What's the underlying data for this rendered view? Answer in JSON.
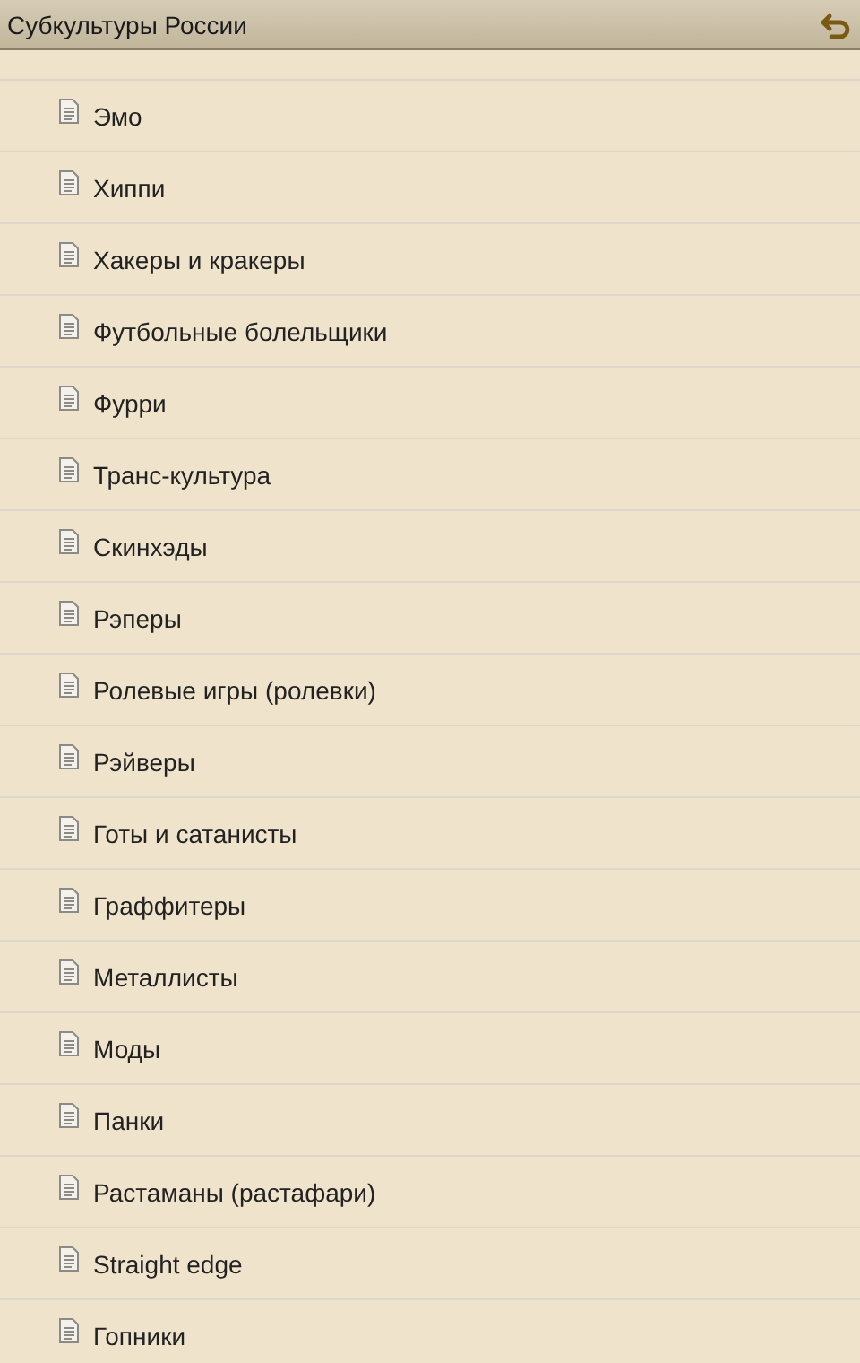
{
  "title_bar": {
    "title": "Субкультуры России"
  },
  "items": [
    {
      "label": "Эмо"
    },
    {
      "label": "Хиппи"
    },
    {
      "label": "Хакеры и кракеры"
    },
    {
      "label": "Футбольные болельщики"
    },
    {
      "label": "Фурри"
    },
    {
      "label": "Транс-культура"
    },
    {
      "label": "Скинхэды"
    },
    {
      "label": "Рэперы"
    },
    {
      "label": "Ролевые игры (ролевки)"
    },
    {
      "label": "Рэйверы"
    },
    {
      "label": "Готы и сатанисты"
    },
    {
      "label": "Граффитеры"
    },
    {
      "label": "Металлисты"
    },
    {
      "label": "Моды"
    },
    {
      "label": "Панки"
    },
    {
      "label": "Растаманы (растафари)"
    },
    {
      "label": "Straight edge"
    },
    {
      "label": "Гопники"
    }
  ]
}
